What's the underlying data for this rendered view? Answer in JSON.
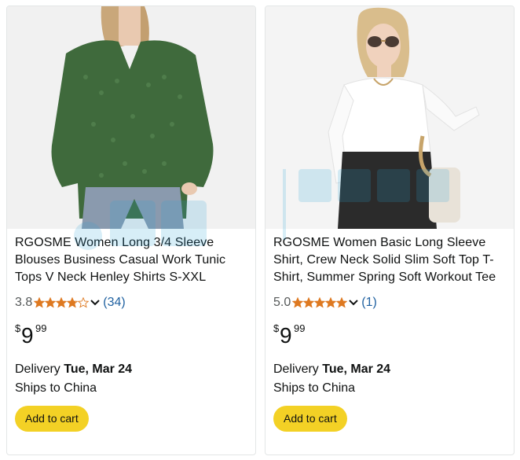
{
  "products": [
    {
      "title": "RGOSME Women Long 3/4 Sleeve Blouses Business Casual Work Tunic Tops V Neck Henley Shirts S-XXL",
      "rating": "3.8",
      "stars": 3.8,
      "review_count": "(34)",
      "price_symbol": "$",
      "price_whole": "9",
      "price_fraction": "99",
      "delivery_prefix": "Delivery ",
      "delivery_date": "Tue, Mar 24",
      "ships": "Ships to China",
      "button_label": "Add to cart",
      "image_icon": "product-photo-green-blouse"
    },
    {
      "title": "RGOSME Women Basic Long Sleeve Shirt, Crew Neck Solid Slim Soft Top T-Shirt, Summer Spring Soft Workout Tee",
      "rating": "5.0",
      "stars": 5.0,
      "review_count": "(1)",
      "price_symbol": "$",
      "price_whole": "9",
      "price_fraction": "99",
      "delivery_prefix": "Delivery ",
      "delivery_date": "Tue, Mar 24",
      "ships": "Ships to China",
      "button_label": "Add to cart",
      "image_icon": "product-photo-white-tee"
    }
  ],
  "colors": {
    "star": "#de7921",
    "link": "#2162a1",
    "button": "#f3d125"
  }
}
